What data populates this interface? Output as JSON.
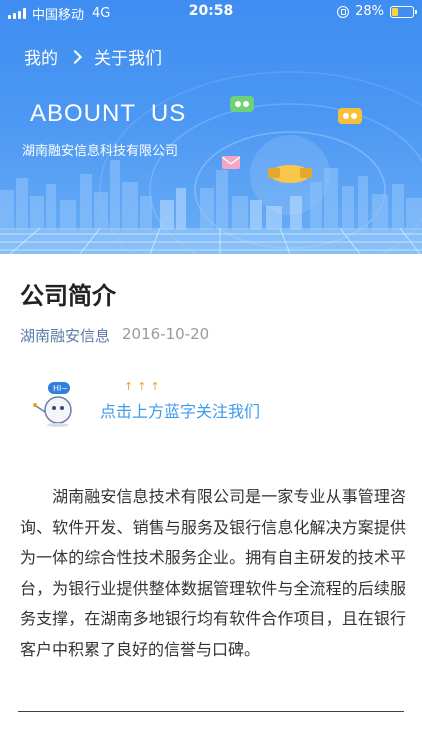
{
  "status_bar": {
    "carrier": "中国移动",
    "network": "4G",
    "time": "20:58",
    "battery_percent": "28%",
    "battery_level": 0.28
  },
  "nav": {
    "back_label": "我的",
    "current_label": "关于我们"
  },
  "banner": {
    "title": "ABOUNT  US",
    "subtitle": "湖南融安信息科技有限公司",
    "accent": "#4b97f3"
  },
  "article": {
    "title": "公司简介",
    "source": "湖南融安信息",
    "date": "2016-10-20",
    "follow_prompt": "点击上方蓝字关注我们",
    "body": "湖南融安信息技术有限公司是一家专业从事管理咨询、软件开发、销售与服务及银行信息化解决方案提供为一体的综合性技术服务企业。拥有自主研发的技术平台，为银行业提供整体数据管理软件与全流程的后续服务支撑，在湖南多地银行均有软件合作项目，且在银行客户中积累了良好的信誉与口碑。"
  }
}
